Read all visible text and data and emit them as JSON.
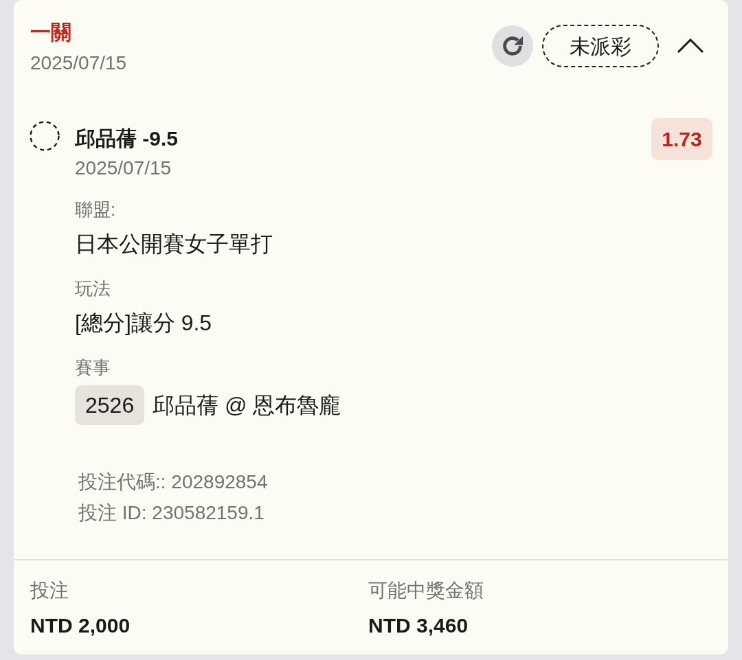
{
  "bet": {
    "title": "一關",
    "date": "2025/07/15",
    "status": "未派彩",
    "expanded": true
  },
  "selection": {
    "pick": "邱品蒨 -9.5",
    "date": "2025/07/15",
    "odds": "1.73",
    "details": [
      {
        "label": "聯盟:",
        "value": "日本公開賽女子單打"
      },
      {
        "label": "玩法",
        "value": "[總分]讓分 9.5"
      },
      {
        "label": "賽事",
        "event_number": "2526",
        "value": "邱品蒨 @ 恩布魯龐"
      }
    ]
  },
  "references": [
    "投注代碼:: 202892854",
    "投注 ID: 230582159.1"
  ],
  "summary": [
    {
      "label": "投注",
      "amount": "NTD 2,000"
    },
    {
      "label": "可能中獎金額",
      "amount": "NTD 3,460"
    }
  ]
}
